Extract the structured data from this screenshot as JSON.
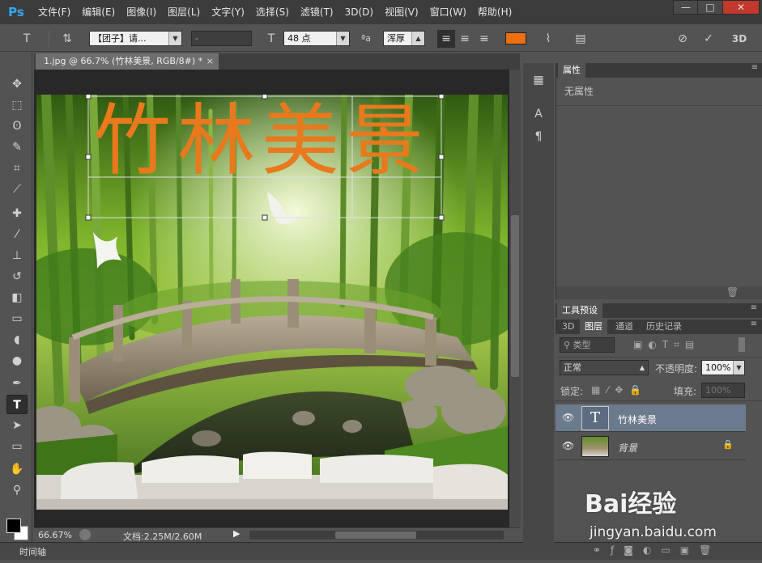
{
  "app": {
    "logo": "Ps"
  },
  "menu": [
    "文件(F)",
    "编辑(E)",
    "图像(I)",
    "图层(L)",
    "文字(Y)",
    "选择(S)",
    "滤镜(T)",
    "3D(D)",
    "视图(V)",
    "窗口(W)",
    "帮助(H)"
  ],
  "window_controls": {
    "minimize": "—",
    "maximize": "□",
    "close": "✕"
  },
  "options": {
    "font_family": "【团子】请...",
    "font_style": "-",
    "font_size": "48 点",
    "antialias": "浑厚",
    "text_color": "#ee6f10",
    "three_d": "3D"
  },
  "document": {
    "tab_title": "1.jpg @ 66.7% (竹林美景, RGB/8#) *",
    "canvas_text": "竹林美景",
    "text_color": "#e8791c",
    "zoom": "66.67%",
    "doc_size": "文档:2.25M/2.60M"
  },
  "timeline_label": "时间轴",
  "properties": {
    "tab": "属性",
    "empty": "无属性"
  },
  "tool_presets": {
    "tab": "工具预设"
  },
  "layers_panel": {
    "tabs": [
      "3D",
      "图层",
      "通道",
      "历史记录"
    ],
    "filter_kind": "类型",
    "blend_mode": "正常",
    "opacity_label": "不透明度:",
    "opacity": "100%",
    "lock_label": "锁定:",
    "fill_label": "填充:",
    "fill": "100%",
    "layers": [
      {
        "name": "竹林美景",
        "type": "text",
        "selected": true
      },
      {
        "name": "背景",
        "type": "image",
        "selected": false
      }
    ]
  },
  "watermark": {
    "brand": "Bai经验",
    "url": "jingyan.baidu.com"
  }
}
